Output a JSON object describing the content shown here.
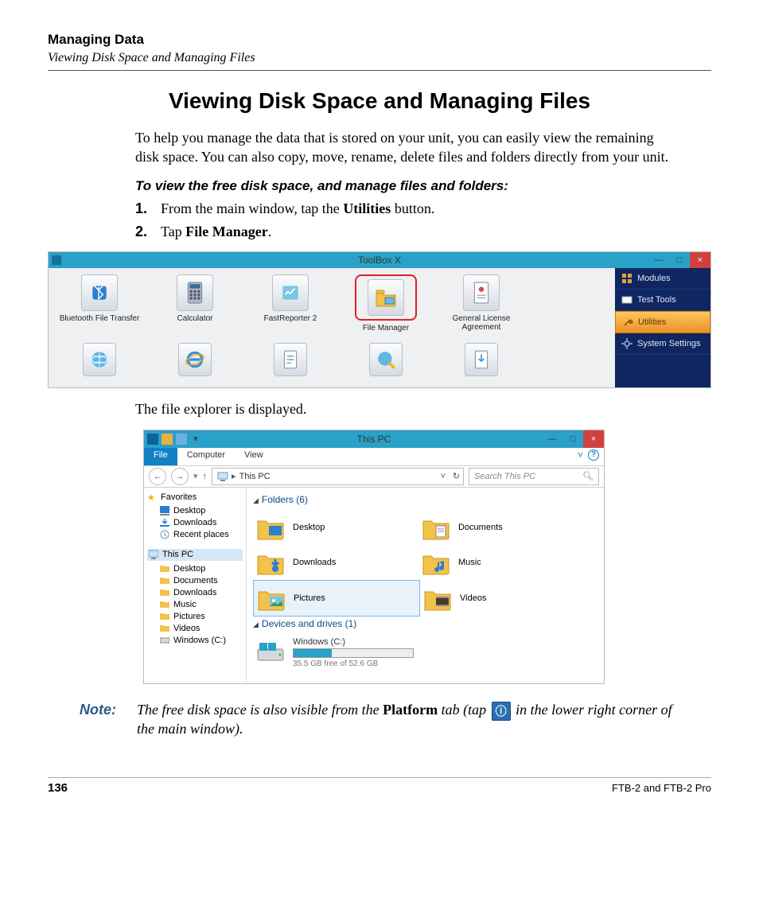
{
  "header": {
    "chapter": "Managing Data",
    "sub": "Viewing Disk Space and Managing Files"
  },
  "section_title": "Viewing Disk Space and Managing Files",
  "intro": "To help you manage the data that is stored on your unit, you can easily view the remaining disk space. You can also copy, move, rename, delete files and folders directly from your unit.",
  "instruction_head": "To view the free disk space, and manage files and folders:",
  "steps": {
    "s1_pre": "From the main window, tap the ",
    "s1_bold": "Utilities",
    "s1_post": " button.",
    "s2_pre": "Tap ",
    "s2_bold": "File Manager",
    "s2_post": "."
  },
  "mid_text": "The file explorer is displayed.",
  "note": {
    "label": "Note:",
    "pre": "The free disk space is also visible from the ",
    "bold": "Platform",
    "mid": " tab (tap ",
    "post": " in the lower right corner of the main window)."
  },
  "footer": {
    "page": "136",
    "right": "FTB-2 and FTB-2 Pro"
  },
  "toolbox": {
    "title": "ToolBox X",
    "tiles": [
      "Bluetooth File Transfer",
      "Calculator",
      "FastReporter 2",
      "File Manager",
      "General License Agreement"
    ],
    "sidebar": {
      "modules": "Modules",
      "tests": "Test Tools",
      "utilities": "Utilities",
      "settings": "System Settings"
    },
    "win": {
      "min": "—",
      "max": "□",
      "close": "×"
    }
  },
  "explorer": {
    "title": "This PC",
    "ribbon": {
      "file": "File",
      "computer": "Computer",
      "view": "View"
    },
    "breadcrumb": "This PC",
    "search_placeholder": "Search This PC",
    "tree": {
      "fav_head": "Favorites",
      "fav": [
        "Desktop",
        "Downloads",
        "Recent places"
      ],
      "pc_head": "This PC",
      "pc": [
        "Desktop",
        "Documents",
        "Downloads",
        "Music",
        "Pictures",
        "Videos",
        "Windows (C:)"
      ]
    },
    "main": {
      "folders_head": "Folders (6)",
      "folders": [
        "Desktop",
        "Documents",
        "Downloads",
        "Music",
        "Pictures",
        "Videos"
      ],
      "drives_head": "Devices and drives (1)",
      "drive_name": "Windows (C:)",
      "drive_sub": "35.5 GB free of 52.6 GB",
      "drive_used_pct": 32
    },
    "win": {
      "min": "—",
      "max": "□",
      "close": "×"
    }
  }
}
